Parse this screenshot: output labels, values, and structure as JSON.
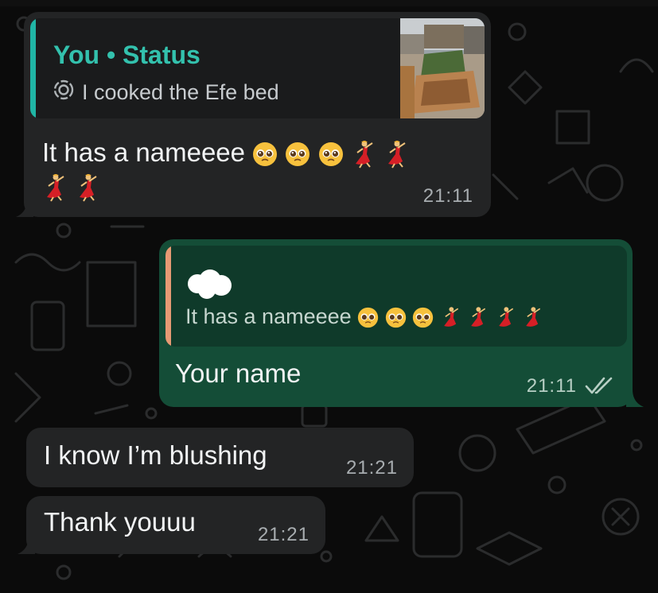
{
  "chat": {
    "messages": [
      {
        "direction": "incoming",
        "quote": {
          "author": "You",
          "type": "Status",
          "separator": "•",
          "status_text": "I cooked the Efe bed",
          "status_icon": "status-ring-icon",
          "has_thumbnail": true
        },
        "text": "It has a nameeee",
        "emojis": [
          "pleading-face",
          "pleading-face",
          "pleading-face",
          "dancer",
          "dancer",
          "dancer",
          "dancer"
        ],
        "time": "21:11"
      },
      {
        "direction": "outgoing",
        "quote": {
          "text": "It has a nameeee",
          "emojis": [
            "pleading-face",
            "pleading-face",
            "pleading-face",
            "dancer",
            "dancer",
            "dancer",
            "dancer"
          ]
        },
        "text": "Your name",
        "time": "21:11",
        "status": "read",
        "status_icon": "double-check-icon"
      },
      {
        "direction": "incoming",
        "text": "I know I’m blushing",
        "time": "21:21"
      },
      {
        "direction": "incoming",
        "text": "Thank youuu",
        "time": "21:21"
      }
    ]
  },
  "colors": {
    "background": "#0b0b0b",
    "incoming_bubble": "#232425",
    "outgoing_bubble": "#144d37",
    "status_accent": "#33c1ad",
    "quote_bar_outgoing": "#e79a74"
  }
}
